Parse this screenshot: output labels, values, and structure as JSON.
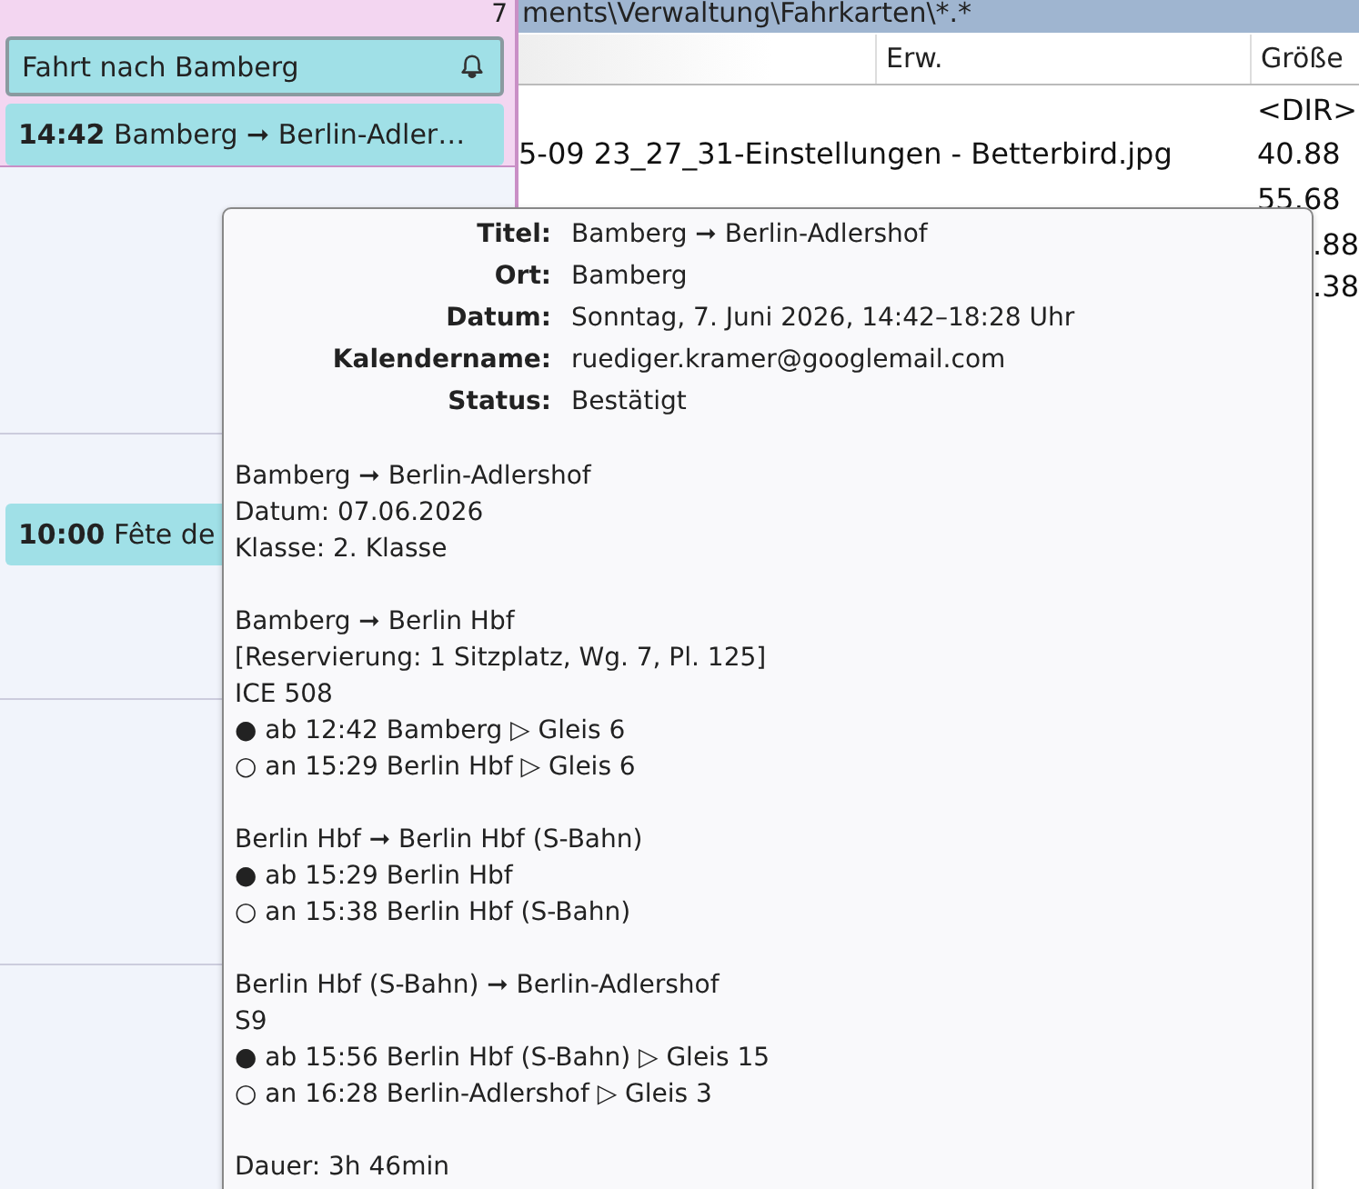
{
  "calendar": {
    "day_number": "7",
    "all_day_events": [
      {
        "kind": "all_day",
        "title": "Fahrt nach Bamberg",
        "reminder": true
      }
    ],
    "day_events": [
      {
        "time": "14:42",
        "title": "Bamberg ➞ Berlin-Adler…"
      }
    ],
    "grid_events": [
      {
        "time": "10:00",
        "title": "Fête de"
      }
    ]
  },
  "file_manager": {
    "path": "ments\\Verwaltung\\Fahrkarten\\*.*",
    "columns": [
      "Erw.",
      "Größe"
    ],
    "rows": [
      {
        "size": "<DIR>"
      },
      {
        "name": "5-09 23_27_31-Einstellungen - Betterbird.jpg",
        "size": "40.88"
      },
      {
        "size": "55.68"
      },
      {
        "size": ".88",
        "partial": true
      },
      {
        "size": ".38",
        "partial": true
      }
    ]
  },
  "tooltip": {
    "fields": [
      {
        "label": "Titel:",
        "value": "Bamberg ➞ Berlin-Adlershof"
      },
      {
        "label": "Ort:",
        "value": "Bamberg"
      },
      {
        "label": "Datum:",
        "value": "Sonntag, 7. Juni 2026, 14:42–18:28 Uhr"
      },
      {
        "label": "Kalendername:",
        "value": "ruediger.kramer@googlemail.com"
      },
      {
        "label": "Status:",
        "value": "Bestätigt"
      }
    ],
    "sections": [
      [
        "Bamberg ➞ Berlin-Adlershof",
        "Datum: 07.06.2026",
        "Klasse: 2. Klasse"
      ],
      [
        "Bamberg ➞ Berlin Hbf",
        "[Reservierung: 1 Sitzplatz, Wg. 7, Pl. 125]",
        "ICE 508",
        "● ab 12:42 Bamberg ▷ Gleis 6",
        "○ an 15:29 Berlin Hbf ▷ Gleis 6"
      ],
      [
        "Berlin Hbf ➞ Berlin Hbf (S-Bahn)",
        "● ab 15:29 Berlin Hbf",
        "○ an 15:38 Berlin Hbf (S-Bahn)"
      ],
      [
        "Berlin Hbf (S-Bahn) ➞ Berlin-Adlershof",
        "S9",
        "● ab 15:56 Berlin Hbf (S-Bahn) ▷ Gleis 15",
        "○ an 16:28 Berlin-Adlershof ▷ Gleis 3"
      ],
      [
        "Dauer: 3h 46min"
      ]
    ]
  }
}
